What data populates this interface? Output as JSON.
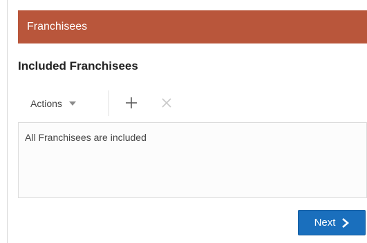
{
  "header": {
    "title": "Franchisees",
    "color": "#b9563b"
  },
  "section": {
    "title": "Included Franchisees"
  },
  "toolbar": {
    "actions_label": "Actions",
    "actions_icon": "caret-down-icon",
    "add_icon": "plus-icon",
    "remove_icon": "close-icon"
  },
  "list": {
    "empty_message": "All Franchisees are included"
  },
  "footer": {
    "next_label": "Next",
    "next_icon": "chevron-right-icon",
    "next_color": "#1a6fbd"
  }
}
